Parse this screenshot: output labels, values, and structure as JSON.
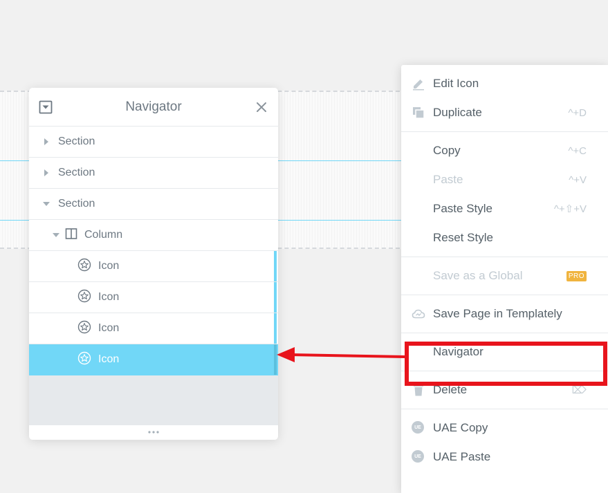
{
  "navigator": {
    "title": "Navigator",
    "rows": [
      {
        "label": "Section",
        "kind": "section",
        "expanded": false
      },
      {
        "label": "Section",
        "kind": "section",
        "expanded": false
      },
      {
        "label": "Section",
        "kind": "section",
        "expanded": true
      },
      {
        "label": "Column",
        "kind": "column",
        "expanded": true
      },
      {
        "label": "Icon",
        "kind": "icon",
        "active": false
      },
      {
        "label": "Icon",
        "kind": "icon",
        "active": false
      },
      {
        "label": "Icon",
        "kind": "icon",
        "active": false
      },
      {
        "label": "Icon",
        "kind": "icon",
        "active": true
      }
    ]
  },
  "context_menu": {
    "groups": [
      [
        {
          "label": "Edit Icon",
          "icon": "pencil-icon",
          "shortcut": "",
          "disabled": false
        },
        {
          "label": "Duplicate",
          "icon": "duplicate-icon",
          "shortcut": "^+D",
          "disabled": false
        }
      ],
      [
        {
          "label": "Copy",
          "icon": "",
          "shortcut": "^+C",
          "disabled": false
        },
        {
          "label": "Paste",
          "icon": "",
          "shortcut": "^+V",
          "disabled": true
        },
        {
          "label": "Paste Style",
          "icon": "",
          "shortcut": "^+⇧+V",
          "disabled": false
        },
        {
          "label": "Reset Style",
          "icon": "",
          "shortcut": "",
          "disabled": false
        }
      ],
      [
        {
          "label": "Save as a Global",
          "icon": "",
          "shortcut": "",
          "disabled": true,
          "badge": "PRO"
        }
      ],
      [
        {
          "label": "Save Page in Templately",
          "icon": "cloud-icon",
          "shortcut": "",
          "disabled": false
        }
      ],
      [
        {
          "label": "Navigator",
          "icon": "",
          "shortcut": "",
          "disabled": false
        }
      ],
      [
        {
          "label": "Delete",
          "icon": "trash-icon",
          "shortcut": "⌦",
          "disabled": false
        }
      ],
      [
        {
          "label": "UAE Copy",
          "icon": "uae-icon",
          "shortcut": "",
          "disabled": false,
          "icon_text": "UE"
        },
        {
          "label": "UAE Paste",
          "icon": "uae-icon",
          "shortcut": "",
          "disabled": false,
          "icon_text": "UE"
        }
      ]
    ]
  },
  "colors": {
    "accent": "#71d7f7",
    "highlight": "#e8141c",
    "pro": "#f0b43f"
  }
}
